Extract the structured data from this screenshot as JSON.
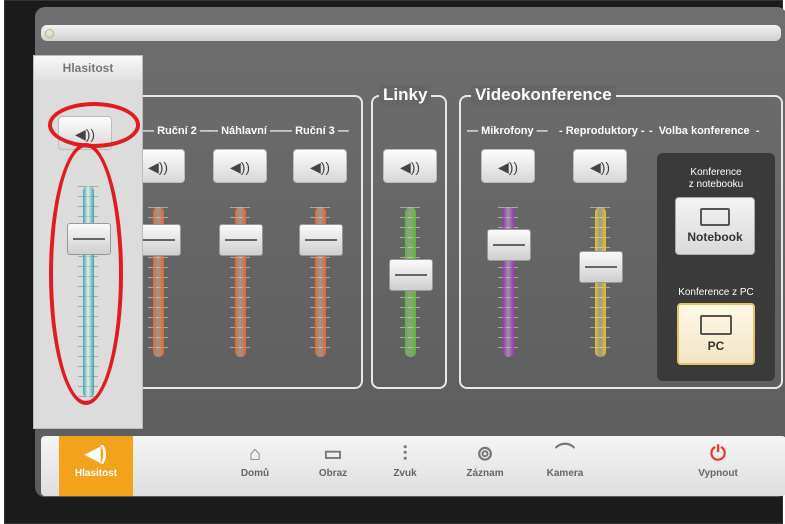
{
  "window": {
    "status_dot_color": "#8fcf6a"
  },
  "popup": {
    "title": "Hlasitost",
    "mute_glyph": "◀))",
    "volume_level": 0.75,
    "track_color": "#3aa7b0"
  },
  "panels": {
    "linky": {
      "title": "Linky"
    },
    "videokonference": {
      "title": "Videokonference"
    }
  },
  "channels": [
    {
      "label": "Ruční 2",
      "mute_glyph": "◀))",
      "color": "#e9662c",
      "level": 0.78
    },
    {
      "label": "Náhlavní",
      "mute_glyph": "◀))",
      "color": "#e9662c",
      "level": 0.78
    },
    {
      "label": "Ruční 3",
      "mute_glyph": "◀))",
      "color": "#e9662c",
      "level": 0.78
    },
    {
      "label": "",
      "mute_glyph": "◀))",
      "color": "#52c21f",
      "level": 0.55
    },
    {
      "label": "Mikrofony",
      "mute_glyph": "◀))",
      "color": "#a42cc6",
      "level": 0.75
    },
    {
      "label": "Reproduktory",
      "mute_glyph": "◀))",
      "color": "#e6c21c",
      "level": 0.6
    }
  ],
  "conference": {
    "title": "Volba konference",
    "notebook_caption_1": "Konference",
    "notebook_caption_2": "z notebooku",
    "notebook_label": "Notebook",
    "pc_caption": "Konference z PC",
    "pc_label": "PC"
  },
  "taskbar": {
    "items": [
      {
        "label": "Hlasitost",
        "icon": "speaker-icon",
        "glyph": "◀)"
      },
      {
        "label": "Domů",
        "icon": "home-icon",
        "glyph": "⌂"
      },
      {
        "label": "Obraz",
        "icon": "monitor-icon",
        "glyph": "▭"
      },
      {
        "label": "Zvuk",
        "icon": "mixer-icon",
        "glyph": "⫶"
      },
      {
        "label": "Záznam",
        "icon": "recorder-icon",
        "glyph": "⊚"
      },
      {
        "label": "Kamera",
        "icon": "camera-icon",
        "glyph": "⌒"
      },
      {
        "label": "Vypnout",
        "icon": "power-icon",
        "glyph": "⏻"
      }
    ],
    "active_color": "#f2a31b",
    "power_color": "#e0402a"
  }
}
